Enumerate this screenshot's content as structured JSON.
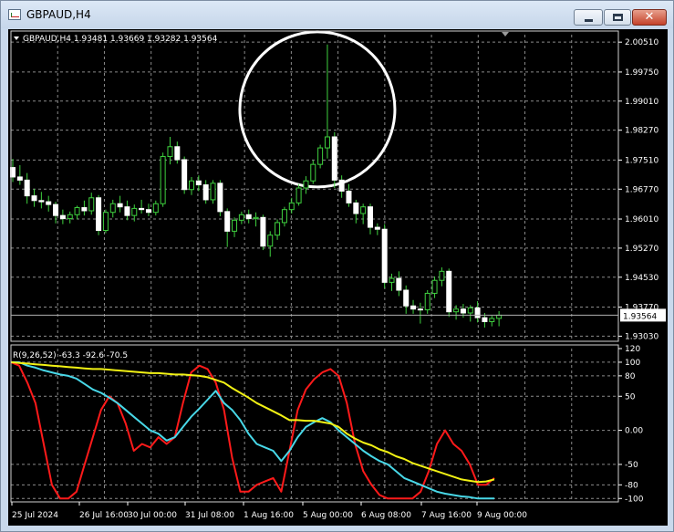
{
  "window": {
    "title": "GBPAUD,H4",
    "minimize_label": "",
    "maximize_label": "",
    "close_label": "✕"
  },
  "main_chart": {
    "header": "GBPAUD,H4  1.93481 1.93669 1.93282 1.93564",
    "current_price": "1.93564",
    "price_labels": [
      "2.00510",
      "1.99750",
      "1.99010",
      "1.98270",
      "1.97510",
      "1.96770",
      "1.96010",
      "1.95270",
      "1.94530",
      "1.93770",
      "1.93030"
    ]
  },
  "indicator": {
    "header": "R(9,26,52) -63.3 -92.6 -70.5",
    "scale_labels": [
      "120",
      "100",
      "80",
      "50",
      "0.00",
      "-50",
      "-80",
      "-100"
    ]
  },
  "time_axis": {
    "labels": [
      "25 Jul 2024",
      "26 Jul 16:00",
      "30 Jul 00:00",
      "31 Jul 08:00",
      "1 Aug 16:00",
      "5 Aug 00:00",
      "6 Aug 08:00",
      "7 Aug 16:00",
      "9 Aug 00:00"
    ]
  },
  "colors": {
    "background": "#000000",
    "grid": "#8a8a8a",
    "candle": "#3fd13f",
    "fast_line": "#ff1a1a",
    "mid_line": "#48d8e8",
    "slow_line": "#f2f214",
    "annotation_circle": "#ffffff"
  },
  "chart_data": [
    {
      "type": "candlestick",
      "title": "GBPAUD,H4",
      "symbol": "GBPAUD",
      "timeframe": "H4",
      "last_bar": {
        "open": 1.93481,
        "high": 1.93669,
        "low": 1.93282,
        "close": 1.93564
      },
      "ylim": [
        1.929,
        2.007
      ],
      "x_labels": [
        "25 Jul 2024",
        "26 Jul 16:00",
        "30 Jul 00:00",
        "31 Jul 08:00",
        "1 Aug 16:00",
        "5 Aug 00:00",
        "6 Aug 08:00",
        "7 Aug 16:00",
        "9 Aug 00:00"
      ],
      "ohlc": [
        [
          1.9732,
          1.9754,
          1.9695,
          1.9708
        ],
        [
          1.9708,
          1.9738,
          1.9688,
          1.97
        ],
        [
          1.97,
          1.9718,
          1.964,
          1.966
        ],
        [
          1.966,
          1.9678,
          1.9632,
          1.9648
        ],
        [
          1.9648,
          1.967,
          1.9628,
          1.9645
        ],
        [
          1.9645,
          1.966,
          1.962,
          1.9638
        ],
        [
          1.9638,
          1.9645,
          1.959,
          1.961
        ],
        [
          1.961,
          1.9625,
          1.9588,
          1.9602
        ],
        [
          1.9602,
          1.962,
          1.959,
          1.9612
        ],
        [
          1.9612,
          1.9635,
          1.96,
          1.963
        ],
        [
          1.963,
          1.9648,
          1.961,
          1.9622
        ],
        [
          1.9622,
          1.9668,
          1.9612,
          1.9655
        ],
        [
          1.9655,
          1.9662,
          1.956,
          1.9572
        ],
        [
          1.9572,
          1.9625,
          1.9565,
          1.9618
        ],
        [
          1.9618,
          1.965,
          1.9605,
          1.964
        ],
        [
          1.964,
          1.966,
          1.9618,
          1.9632
        ],
        [
          1.9632,
          1.9648,
          1.9598,
          1.961
        ],
        [
          1.961,
          1.9638,
          1.9595,
          1.9628
        ],
        [
          1.9628,
          1.965,
          1.9615,
          1.9625
        ],
        [
          1.9625,
          1.964,
          1.9608,
          1.9618
        ],
        [
          1.9618,
          1.9648,
          1.961,
          1.964
        ],
        [
          1.964,
          1.977,
          1.9632,
          1.976
        ],
        [
          1.976,
          1.981,
          1.974,
          1.9785
        ],
        [
          1.9785,
          1.9798,
          1.9742,
          1.9752
        ],
        [
          1.9752,
          1.976,
          1.9665,
          1.9676
        ],
        [
          1.9676,
          1.9708,
          1.9662,
          1.9698
        ],
        [
          1.9698,
          1.9712,
          1.9672,
          1.9688
        ],
        [
          1.9688,
          1.97,
          1.964,
          1.965
        ],
        [
          1.965,
          1.97,
          1.964,
          1.9692
        ],
        [
          1.9692,
          1.97,
          1.9608,
          1.962
        ],
        [
          1.962,
          1.9628,
          1.953,
          1.957
        ],
        [
          1.957,
          1.9605,
          1.9555,
          1.9598
        ],
        [
          1.9598,
          1.962,
          1.9588,
          1.9612
        ],
        [
          1.9612,
          1.9625,
          1.959,
          1.9602
        ],
        [
          1.9602,
          1.9618,
          1.9582,
          1.9605
        ],
        [
          1.9605,
          1.9612,
          1.9522,
          1.9532
        ],
        [
          1.9532,
          1.957,
          1.9505,
          1.956
        ],
        [
          1.956,
          1.96,
          1.9548,
          1.9592
        ],
        [
          1.9592,
          1.9632,
          1.9582,
          1.9625
        ],
        [
          1.9625,
          1.9655,
          1.9615,
          1.9642
        ],
        [
          1.9642,
          1.969,
          1.9635,
          1.968
        ],
        [
          1.968,
          1.971,
          1.9665,
          1.9698
        ],
        [
          1.9698,
          1.975,
          1.969,
          1.974
        ],
        [
          1.974,
          1.979,
          1.973,
          1.9782
        ],
        [
          1.9782,
          2.0045,
          1.9755,
          1.981
        ],
        [
          1.981,
          1.9822,
          1.968,
          1.97
        ],
        [
          1.97,
          1.9712,
          1.9655,
          1.9672
        ],
        [
          1.9672,
          1.969,
          1.9632,
          1.9642
        ],
        [
          1.9642,
          1.965,
          1.959,
          1.9615
        ],
        [
          1.9615,
          1.964,
          1.9588,
          1.9632
        ],
        [
          1.9632,
          1.964,
          1.9562,
          1.958
        ],
        [
          1.958,
          1.959,
          1.956,
          1.9575
        ],
        [
          1.9575,
          1.9588,
          1.9425,
          1.944
        ],
        [
          1.944,
          1.9462,
          1.9418,
          1.945
        ],
        [
          1.945,
          1.9468,
          1.9405,
          1.942
        ],
        [
          1.942,
          1.9432,
          1.936,
          1.938
        ],
        [
          1.938,
          1.9395,
          1.936,
          1.9372
        ],
        [
          1.9372,
          1.9388,
          1.9335,
          1.937
        ],
        [
          1.937,
          1.942,
          1.936,
          1.9412
        ],
        [
          1.9412,
          1.9455,
          1.94,
          1.9445
        ],
        [
          1.9445,
          1.9478,
          1.943,
          1.9468
        ],
        [
          1.9468,
          1.9475,
          1.9352,
          1.9365
        ],
        [
          1.9365,
          1.9382,
          1.9345,
          1.9372
        ],
        [
          1.9372,
          1.9385,
          1.935,
          1.9362
        ],
        [
          1.9362,
          1.9382,
          1.934,
          1.9375
        ],
        [
          1.9375,
          1.9392,
          1.9338,
          1.935
        ],
        [
          1.935,
          1.9362,
          1.9325,
          1.934
        ],
        [
          1.934,
          1.9355,
          1.9328,
          1.9348
        ],
        [
          1.93481,
          1.93669,
          1.93282,
          1.93564
        ]
      ]
    },
    {
      "type": "line",
      "title": "R(9,26,52) -63.3 -92.6 -70.5",
      "ylim": [
        -105,
        120
      ],
      "series": [
        {
          "name": "",
          "color": "#ff1a1a",
          "values": [
            100,
            95,
            70,
            40,
            -20,
            -80,
            -100,
            -100,
            -90,
            -50,
            -10,
            30,
            50,
            40,
            10,
            -30,
            -20,
            -25,
            -10,
            -20,
            -10,
            40,
            85,
            95,
            90,
            70,
            30,
            -40,
            -90,
            -90,
            -80,
            -75,
            -70,
            -90,
            -30,
            30,
            60,
            75,
            85,
            90,
            80,
            40,
            -20,
            -60,
            -80,
            -95,
            -100,
            -100,
            -100,
            -100,
            -90,
            -60,
            -20,
            0,
            -20,
            -30,
            -50,
            -80,
            -80,
            -70
          ]
        },
        {
          "name": "",
          "color": "#48d8e8",
          "values": [
            100,
            100,
            95,
            92,
            88,
            85,
            82,
            80,
            76,
            68,
            60,
            55,
            48,
            40,
            30,
            20,
            10,
            0,
            -5,
            -15,
            -10,
            5,
            20,
            32,
            45,
            58,
            40,
            30,
            15,
            -5,
            -20,
            -25,
            -30,
            -45,
            -30,
            -10,
            5,
            12,
            18,
            12,
            0,
            -10,
            -20,
            -30,
            -38,
            -45,
            -50,
            -60,
            -70,
            -75,
            -80,
            -85,
            -90,
            -93,
            -95,
            -97,
            -98,
            -100,
            -100,
            -100
          ]
        },
        {
          "name": "",
          "color": "#f2f214",
          "values": [
            100,
            99,
            98,
            97,
            96,
            95,
            94,
            93,
            92,
            91,
            90,
            90,
            89,
            88,
            87,
            86,
            85,
            84,
            84,
            83,
            82,
            82,
            81,
            80,
            78,
            74,
            70,
            62,
            55,
            48,
            40,
            34,
            28,
            22,
            15,
            15,
            14,
            14,
            12,
            10,
            5,
            -5,
            -12,
            -18,
            -22,
            -28,
            -32,
            -38,
            -42,
            -48,
            -52,
            -56,
            -60,
            -64,
            -68,
            -72,
            -74,
            -76,
            -75,
            -72
          ]
        }
      ],
      "scale_labels": [
        "120",
        "100",
        "80",
        "50",
        "0.00",
        "-50",
        "-80",
        "-100"
      ]
    }
  ]
}
